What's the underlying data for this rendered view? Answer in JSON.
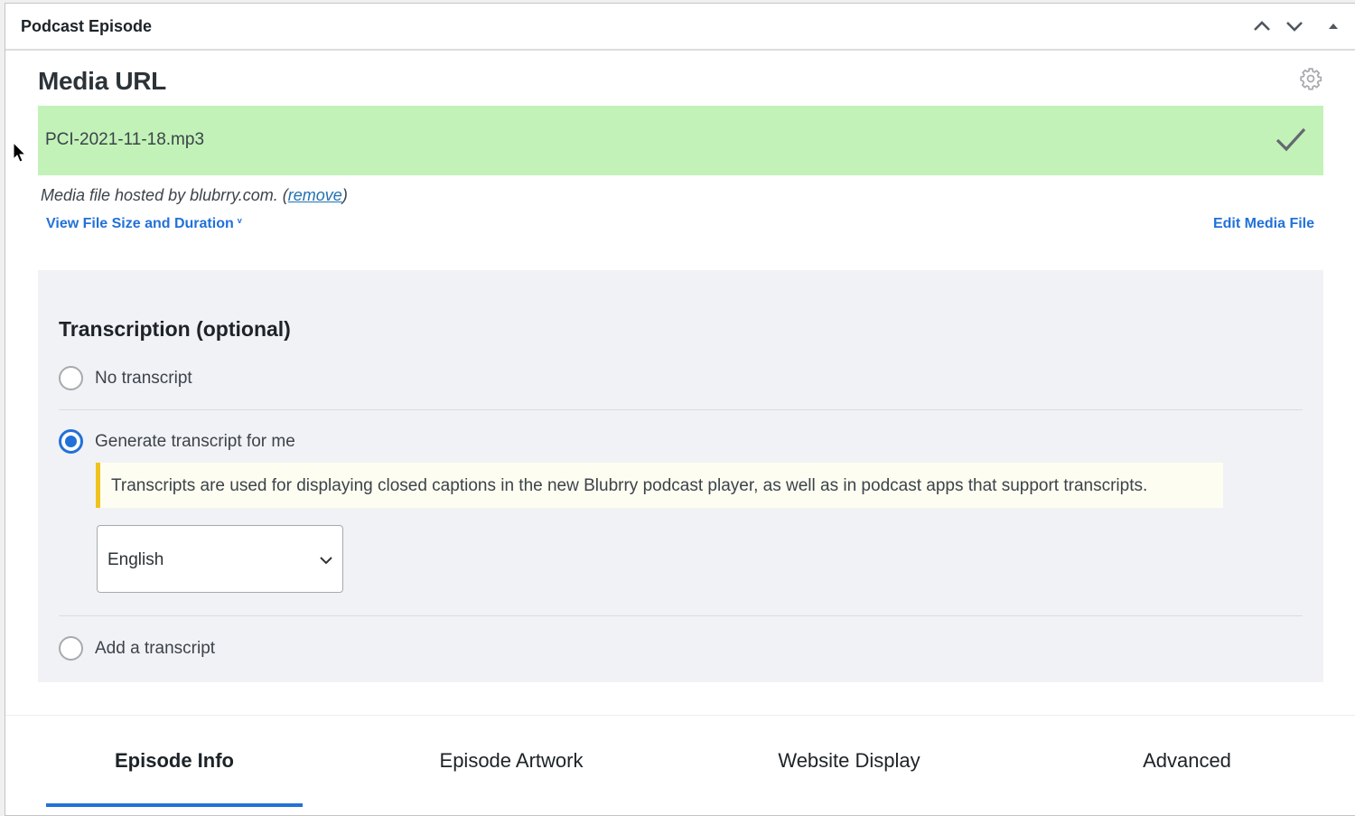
{
  "postbox": {
    "title": "Podcast Episode",
    "controls": [
      "move-up",
      "move-down",
      "toggle-panel"
    ]
  },
  "media": {
    "heading": "Media URL",
    "url_value": "PCI-2021-11-18.mp3",
    "url_status": "valid",
    "hosted_text": "Media file hosted by blubrry.com. (",
    "remove_label": "remove",
    "hosted_close": ")",
    "view_size_label": "View File Size and Duration",
    "view_size_caret": "v",
    "edit_media_label": "Edit Media File",
    "status_color": "#c2f2b8"
  },
  "transcription": {
    "title": "Transcription (optional)",
    "options": [
      {
        "label": "No transcript",
        "checked": false
      },
      {
        "label": "Generate transcript for me",
        "checked": true
      },
      {
        "label": "Add a transcript",
        "checked": false
      }
    ],
    "notice": "Transcripts are used for displaying closed captions in the new Blubrry podcast player, as well as in podcast apps that support transcripts.",
    "language": {
      "selected": "English"
    }
  },
  "tabs": [
    {
      "label": "Episode Info",
      "active": true
    },
    {
      "label": "Episode Artwork",
      "active": false
    },
    {
      "label": "Website Display",
      "active": false
    },
    {
      "label": "Advanced",
      "active": false
    }
  ],
  "colors": {
    "accent": "#2271d8",
    "notice_border": "#f0c31c",
    "panel_bg": "#f1f2f6"
  }
}
